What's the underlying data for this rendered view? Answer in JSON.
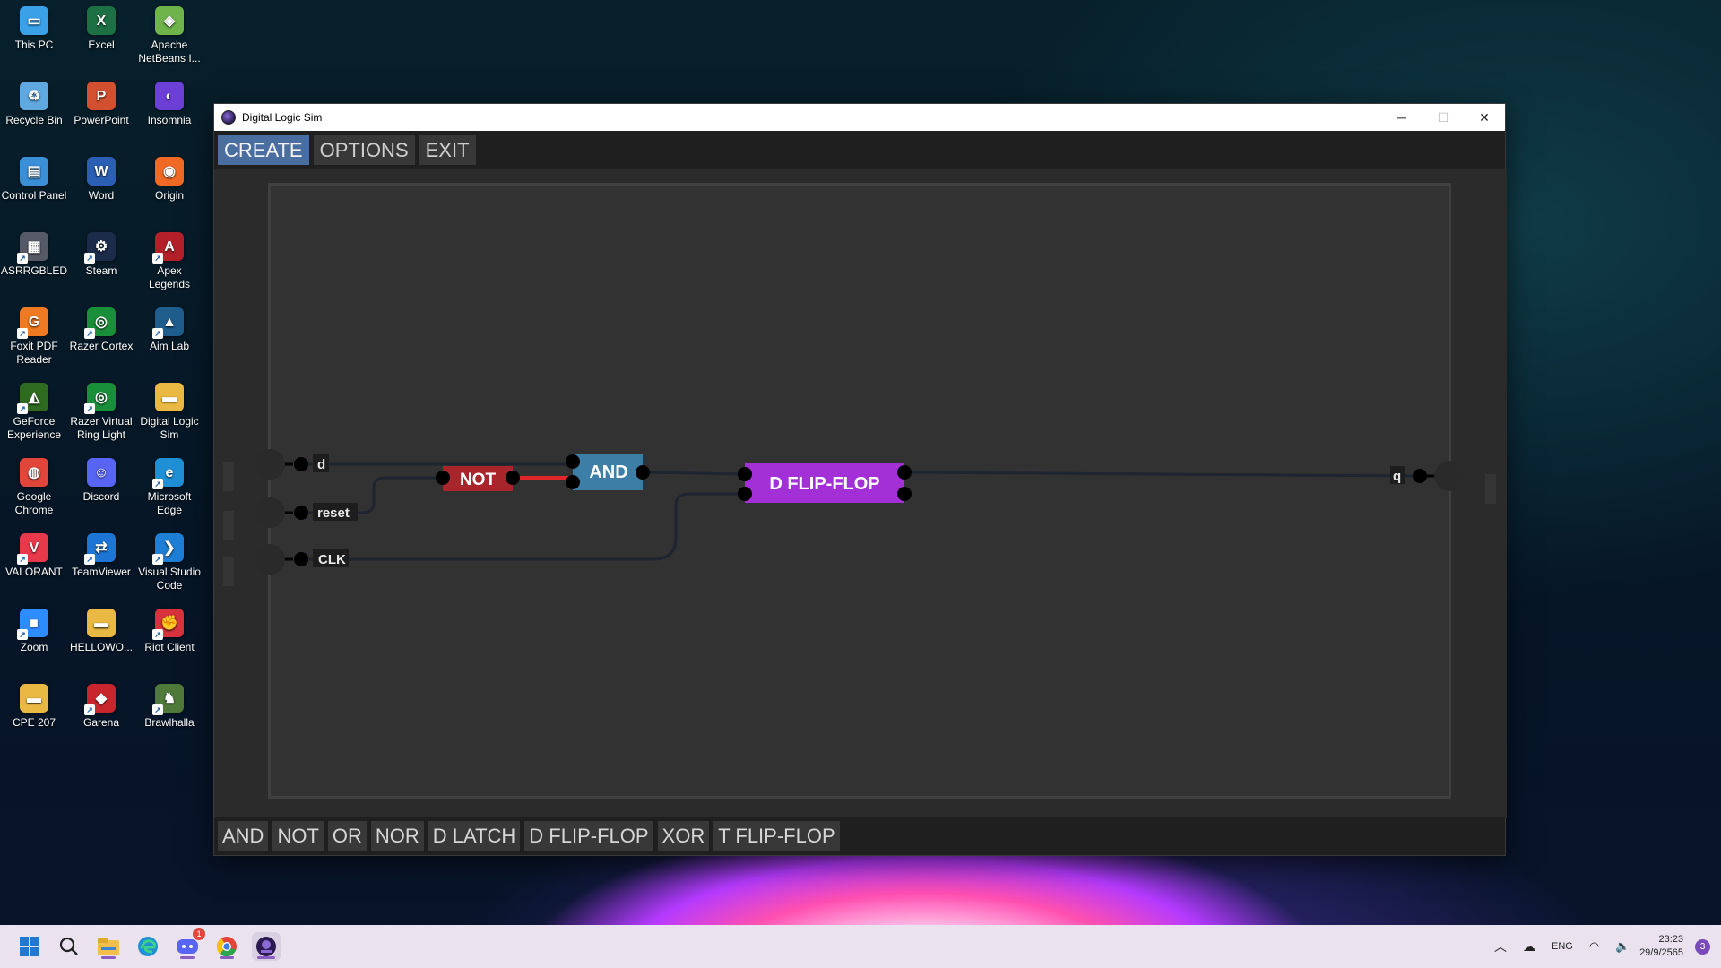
{
  "desktop": {
    "icons": [
      {
        "label": "This PC",
        "icon": "monitor-icon",
        "color": "#3aa0e8",
        "glyph": "▭"
      },
      {
        "label": "Excel",
        "icon": "excel-icon",
        "color": "#1d7044",
        "glyph": "X"
      },
      {
        "label": "Apache NetBeans I...",
        "icon": "netbeans-icon",
        "color": "#6fb34b",
        "glyph": "◈"
      },
      {
        "label": "Recycle Bin",
        "icon": "recycle-bin-icon",
        "color": "#5fa9e0",
        "glyph": "♻"
      },
      {
        "label": "PowerPoint",
        "icon": "powerpoint-icon",
        "color": "#d2502f",
        "glyph": "P"
      },
      {
        "label": "Insomnia",
        "icon": "insomnia-icon",
        "color": "#6c3fd6",
        "glyph": "◐"
      },
      {
        "label": "Control Panel",
        "icon": "control-panel-icon",
        "color": "#3b8fd6",
        "glyph": "▤"
      },
      {
        "label": "Word",
        "icon": "word-icon",
        "color": "#2b5fb3",
        "glyph": "W"
      },
      {
        "label": "Origin",
        "icon": "origin-icon",
        "color": "#f06a26",
        "glyph": "◉"
      },
      {
        "label": "ASRRGBLED",
        "icon": "asrock-led-icon",
        "color": "#555a66",
        "glyph": "▦"
      },
      {
        "label": "Steam",
        "icon": "steam-icon",
        "color": "#1b2b4a",
        "glyph": "⚙"
      },
      {
        "label": "Apex Legends",
        "icon": "apex-legends-icon",
        "color": "#b3202a",
        "glyph": "A"
      },
      {
        "label": "Foxit PDF Reader",
        "icon": "foxit-icon",
        "color": "#f07a22",
        "glyph": "G"
      },
      {
        "label": "Razer Cortex",
        "icon": "razer-cortex-icon",
        "color": "#1a8f3a",
        "glyph": "◎"
      },
      {
        "label": "Aim Lab",
        "icon": "aim-lab-icon",
        "color": "#1e5d8c",
        "glyph": "▲"
      },
      {
        "label": "GeForce Experience",
        "icon": "geforce-icon",
        "color": "#2e6b1f",
        "glyph": "◭"
      },
      {
        "label": "Razer Virtual Ring Light",
        "icon": "razer-ring-icon",
        "color": "#1a8f3a",
        "glyph": "◎"
      },
      {
        "label": "Digital Logic Sim",
        "icon": "folder-icon",
        "color": "#e9b943",
        "glyph": "▬"
      },
      {
        "label": "Google Chrome",
        "icon": "chrome-icon",
        "color": "#e2463a",
        "glyph": "◍"
      },
      {
        "label": "Discord",
        "icon": "discord-icon",
        "color": "#5865f2",
        "glyph": "☺"
      },
      {
        "label": "Microsoft Edge",
        "icon": "edge-icon",
        "color": "#1f8fd6",
        "glyph": "e"
      },
      {
        "label": "VALORANT",
        "icon": "valorant-icon",
        "color": "#e8394a",
        "glyph": "V"
      },
      {
        "label": "TeamViewer",
        "icon": "teamviewer-icon",
        "color": "#1d76d6",
        "glyph": "⇄"
      },
      {
        "label": "Visual Studio Code",
        "icon": "vscode-icon",
        "color": "#1d7fd6",
        "glyph": "❯"
      },
      {
        "label": "Zoom",
        "icon": "zoom-icon",
        "color": "#2d8cff",
        "glyph": "■"
      },
      {
        "label": "HELLOWO...",
        "icon": "folder-icon",
        "color": "#e9b943",
        "glyph": "▬"
      },
      {
        "label": "Riot Client",
        "icon": "riot-client-icon",
        "color": "#d8333d",
        "glyph": "✊"
      },
      {
        "label": "CPE 207",
        "icon": "folder-icon",
        "color": "#e9b943",
        "glyph": "▬"
      },
      {
        "label": "Garena",
        "icon": "garena-icon",
        "color": "#c9252d",
        "glyph": "◆"
      },
      {
        "label": "Brawlhalla",
        "icon": "brawlhalla-icon",
        "color": "#4f7a3a",
        "glyph": "♞"
      }
    ]
  },
  "window": {
    "title": "Digital Logic Sim",
    "controls": {
      "minimize": "─",
      "maximize": "☐",
      "close": "✕"
    },
    "menu": {
      "create": "CREATE",
      "options": "OPTIONS",
      "exit": "EXIT"
    },
    "circuit": {
      "inputs": [
        {
          "label": "d"
        },
        {
          "label": "reset"
        },
        {
          "label": "CLK"
        }
      ],
      "output": {
        "label": "q"
      },
      "gates": {
        "not": {
          "label": "NOT",
          "color": "#a8262b"
        },
        "and": {
          "label": "AND",
          "color": "#3c7ea6"
        },
        "dff": {
          "label": "D FLIP-FLOP",
          "color": "#a32fd6"
        }
      },
      "active_wire_color": "#e0262b",
      "idle_wire_color": "#1e2530"
    },
    "gate_palette": [
      "AND",
      "NOT",
      "OR",
      "NOR",
      "D LATCH",
      "D FLIP-FLOP",
      "XOR",
      "T FLIP-FLOP"
    ]
  },
  "taskbar": {
    "apps": [
      {
        "name": "start",
        "icon": "windows-start-icon"
      },
      {
        "name": "search",
        "icon": "search-icon"
      },
      {
        "name": "file-explorer",
        "icon": "file-explorer-icon"
      },
      {
        "name": "edge",
        "icon": "edge-icon"
      },
      {
        "name": "discord",
        "icon": "discord-icon",
        "badge": "1"
      },
      {
        "name": "chrome",
        "icon": "chrome-icon"
      },
      {
        "name": "digital-logic-sim",
        "icon": "digital-logic-sim-icon"
      }
    ],
    "tray": {
      "language": "ENG"
    },
    "time": "23:23",
    "date": "29/9/2565",
    "notification_count": "3"
  }
}
